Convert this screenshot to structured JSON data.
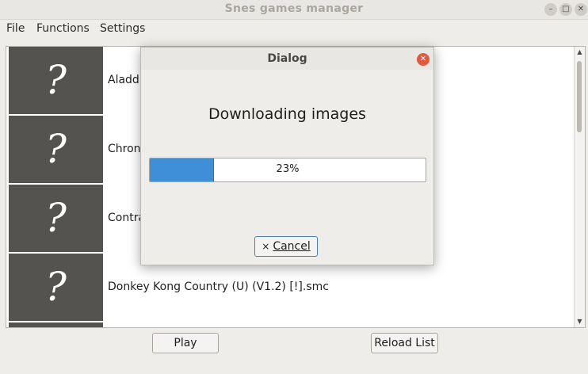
{
  "window": {
    "title": "Snes games manager",
    "controls": [
      "minimize-icon",
      "maximize-icon",
      "close-icon"
    ]
  },
  "menubar": {
    "items": [
      "File",
      "Functions",
      "Settings"
    ]
  },
  "games": {
    "items": [
      {
        "label": "Aladdin",
        "thumb": "?"
      },
      {
        "label": "Chron",
        "thumb": "?"
      },
      {
        "label": "Contra",
        "thumb": "?"
      },
      {
        "label": "Donkey Kong Country (U) (V1.2) [!].smc",
        "thumb": "?"
      },
      {
        "label": "",
        "thumb": ""
      }
    ]
  },
  "buttons": {
    "play": "Play",
    "reload": "Reload List"
  },
  "dialog": {
    "title": "Dialog",
    "message": "Downloading images",
    "progress_percent": 23,
    "progress_text": "23%",
    "cancel_icon": "×",
    "cancel_label": "Cancel"
  },
  "colors": {
    "progress_fill": "#3e8fd6",
    "dialog_close": "#e2583e",
    "thumb_bg": "#55534f"
  }
}
